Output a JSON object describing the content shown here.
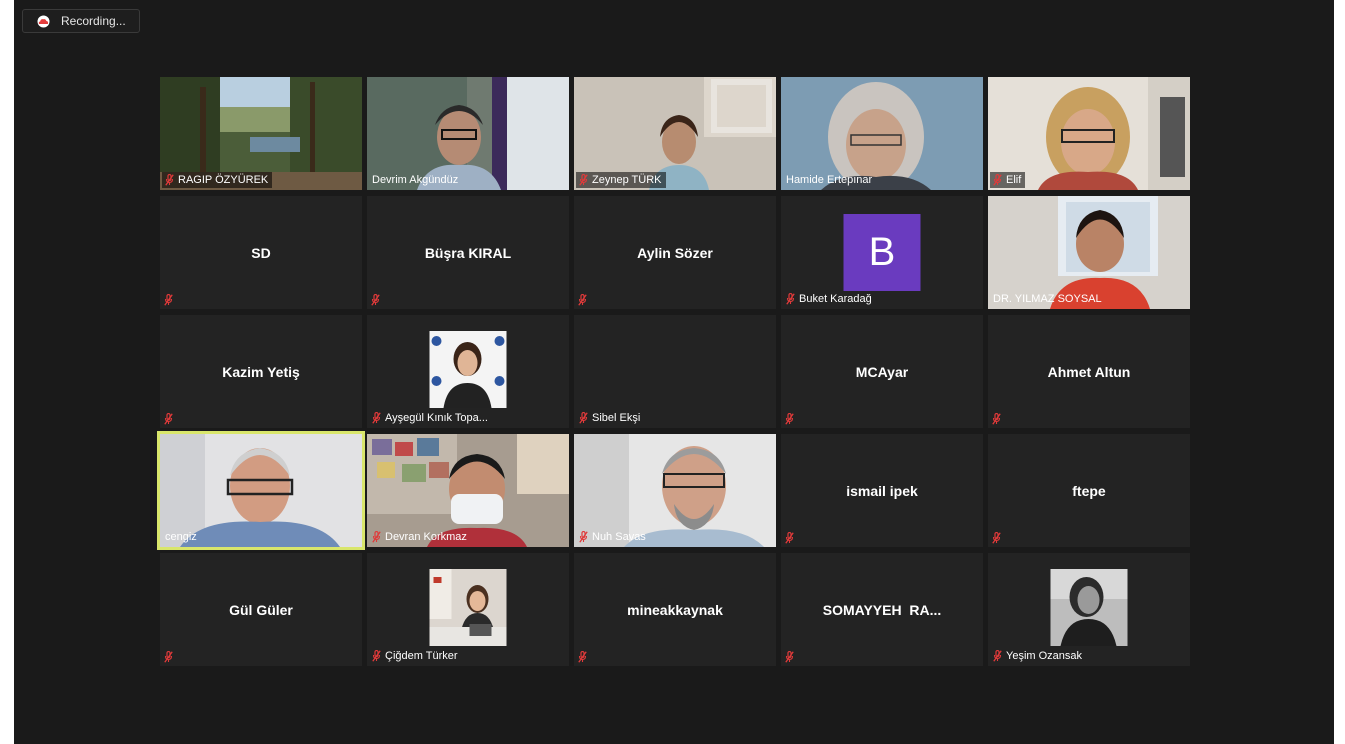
{
  "recording": {
    "label": "Recording..."
  },
  "participants": [
    {
      "name": "RAGIP ÖZYÜREK",
      "muted": true
    },
    {
      "name": "Devrim Akgündüz",
      "muted": false
    },
    {
      "name": "Zeynep TÜRK",
      "muted": true
    },
    {
      "name": "Hamide Ertepınar",
      "muted": false
    },
    {
      "name": "Elif",
      "muted": true
    },
    {
      "name": "SD",
      "muted": true
    },
    {
      "name": "Büşra KIRAL",
      "muted": true
    },
    {
      "name": "Aylin Sözer",
      "muted": true
    },
    {
      "name": "Buket Karadağ",
      "muted": true,
      "avatar_letter": "B"
    },
    {
      "name": "DR. YILMAZ SOYSAL",
      "muted": false
    },
    {
      "name": "Kazim Yetiş",
      "muted": true
    },
    {
      "name": "Ayşegül Kınık Topa...",
      "muted": true
    },
    {
      "name": "Sibel Ekşi",
      "muted": true
    },
    {
      "name": "MCAyar",
      "muted": true
    },
    {
      "name": "Ahmet Altun",
      "muted": true
    },
    {
      "name": "cengiz",
      "muted": false,
      "active_speaker": true
    },
    {
      "name": "Devran Korkmaz",
      "muted": true
    },
    {
      "name": "Nuh Savas",
      "muted": true
    },
    {
      "name": "ismail ipek",
      "muted": true
    },
    {
      "name": "ftepe",
      "muted": true
    },
    {
      "name": "Gül Güler",
      "muted": true
    },
    {
      "name": "Çiğdem Türker",
      "muted": true
    },
    {
      "name": "mineakkaynak",
      "muted": true
    },
    {
      "name": "SOMAYYEH  RA...",
      "muted": true
    },
    {
      "name": "Yeşim Ozansak",
      "muted": true
    }
  ],
  "colors": {
    "background": "#1a1a1a",
    "tile": "#232323",
    "active_border": "#d9e66b",
    "muted_icon": "#e03a3a",
    "avatar": "#6a3bbf"
  }
}
